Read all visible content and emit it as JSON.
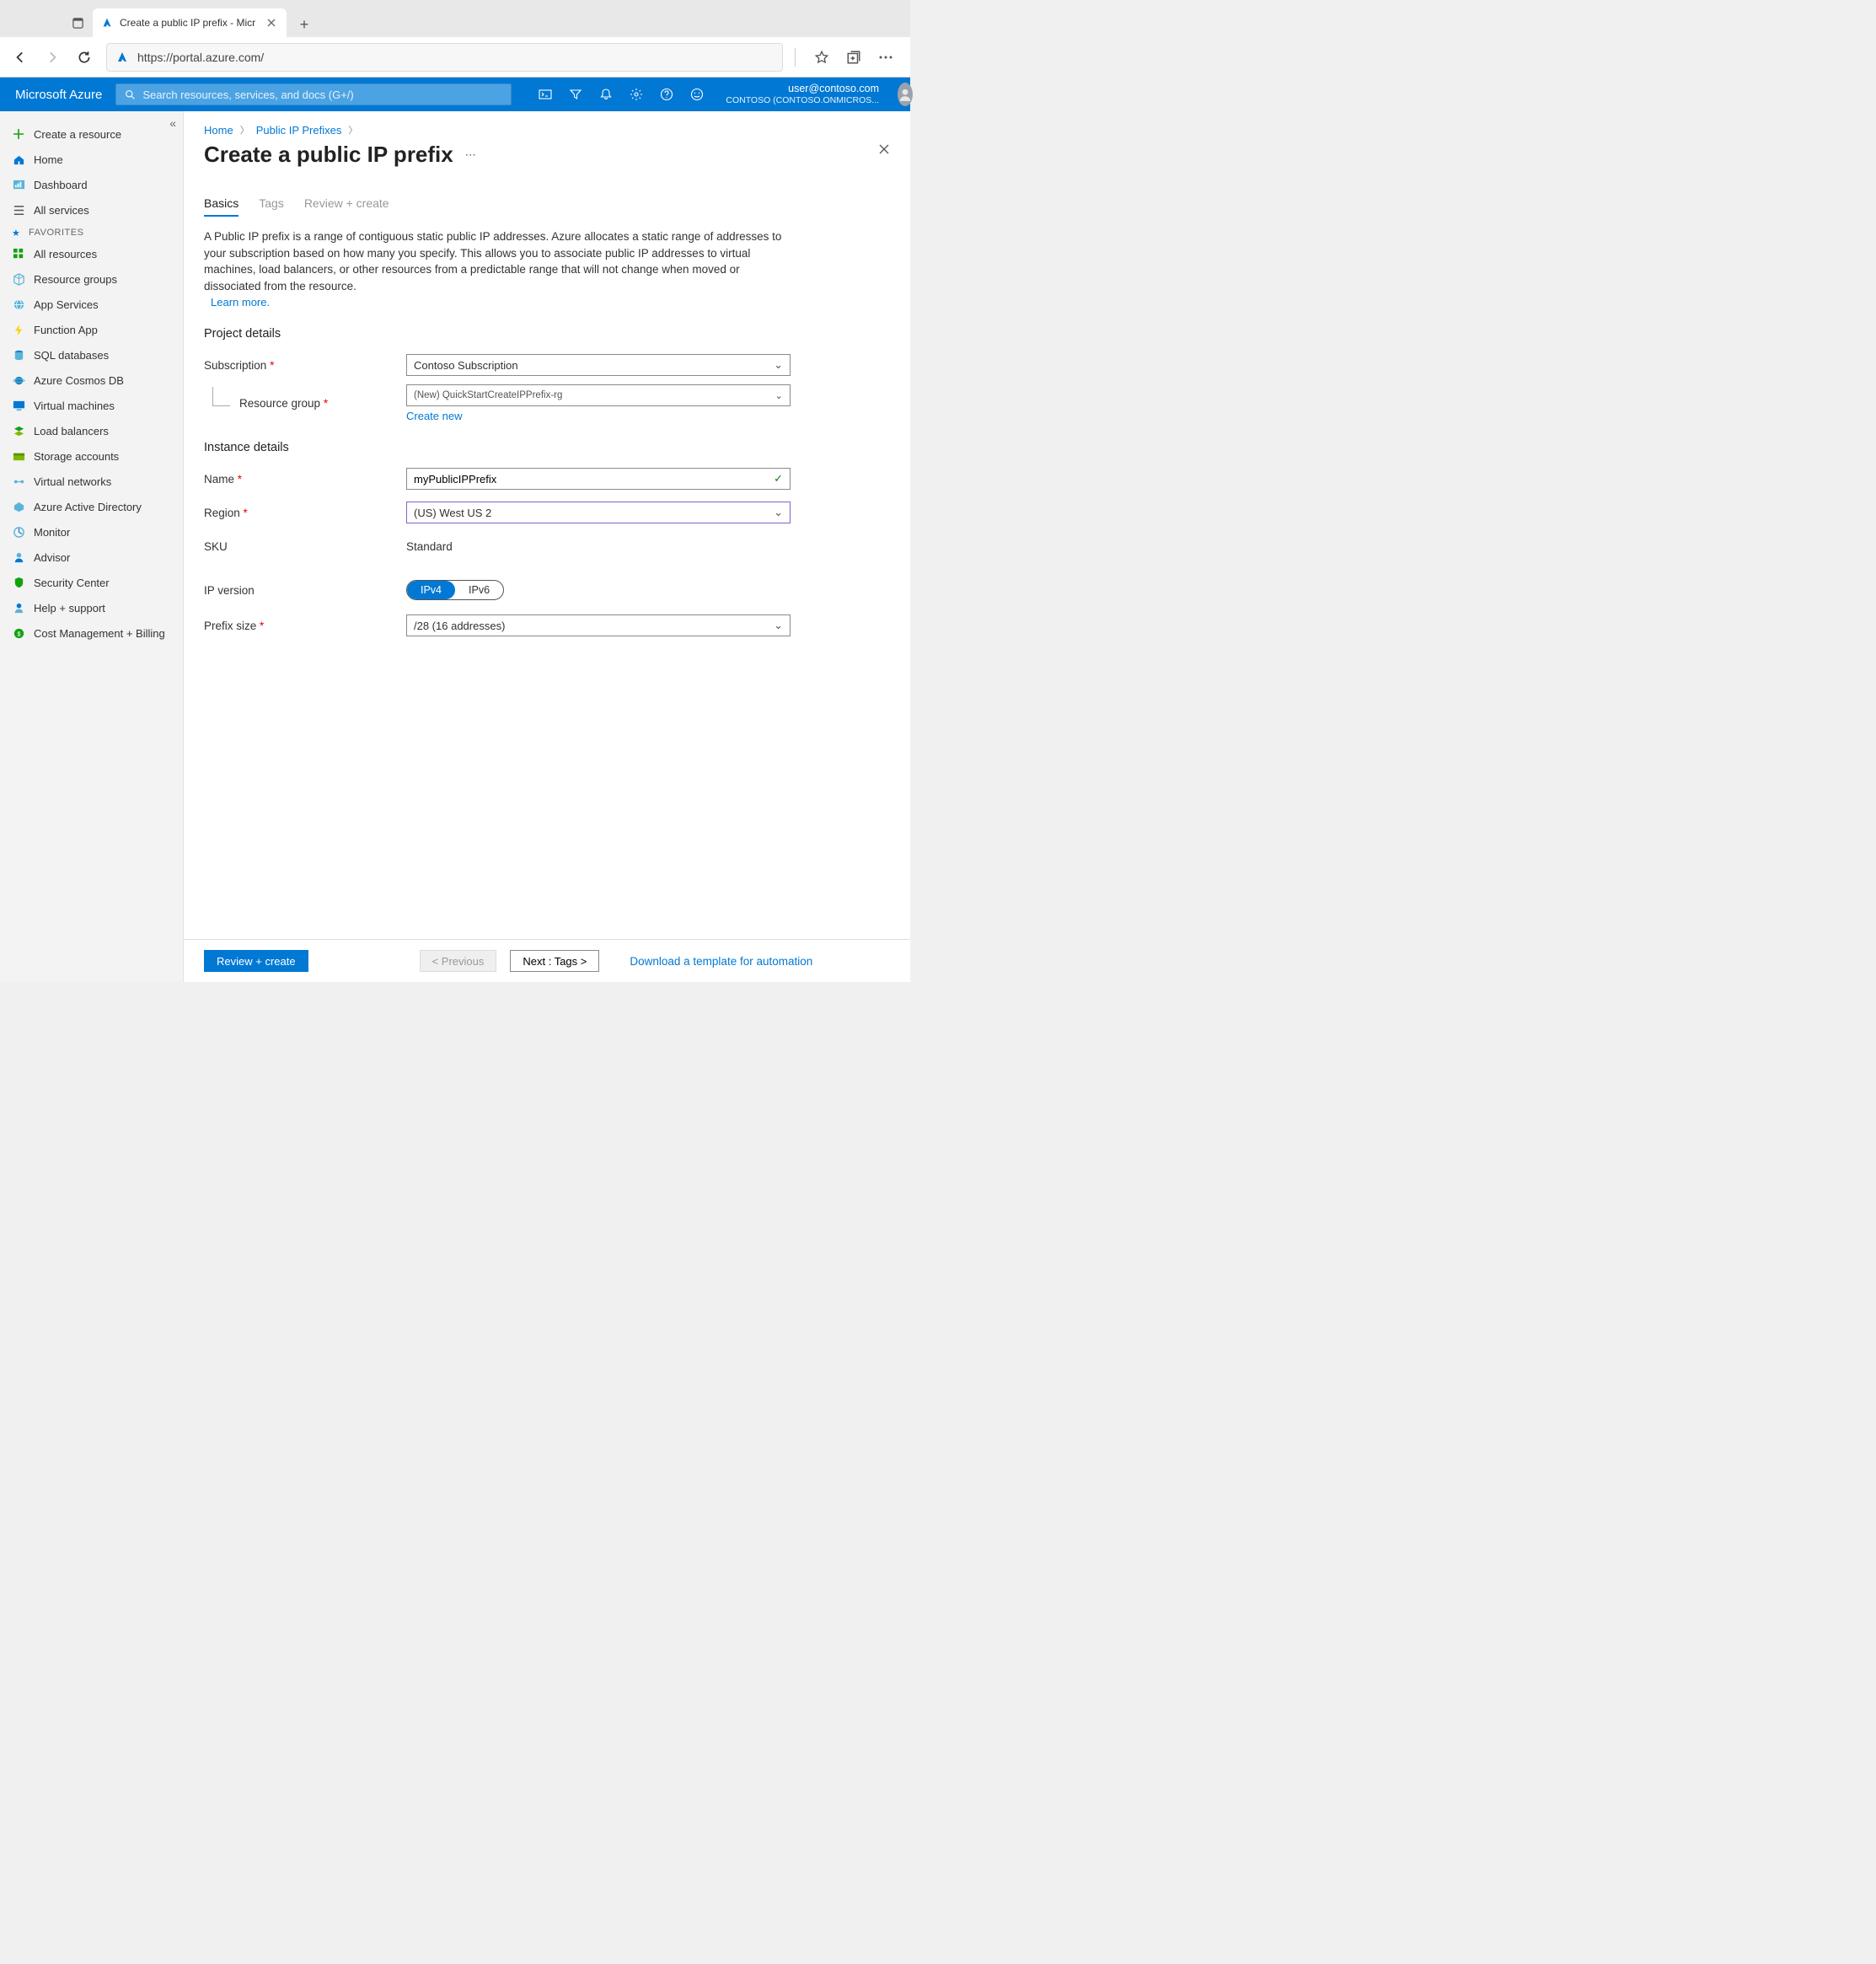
{
  "browser": {
    "tab_title": "Create a public IP prefix - Micr",
    "url": "https://portal.azure.com/"
  },
  "header": {
    "brand": "Microsoft Azure",
    "search_placeholder": "Search resources, services, and docs (G+/)",
    "user_email": "user@contoso.com",
    "user_tenant": "CONTOSO (CONTOSO.ONMICROS..."
  },
  "sidebar": {
    "top": [
      {
        "label": "Create a resource"
      },
      {
        "label": "Home"
      },
      {
        "label": "Dashboard"
      },
      {
        "label": "All services"
      }
    ],
    "fav_header": "FAVORITES",
    "favs": [
      {
        "label": "All resources"
      },
      {
        "label": "Resource groups"
      },
      {
        "label": "App Services"
      },
      {
        "label": "Function App"
      },
      {
        "label": "SQL databases"
      },
      {
        "label": "Azure Cosmos DB"
      },
      {
        "label": "Virtual machines"
      },
      {
        "label": "Load balancers"
      },
      {
        "label": "Storage accounts"
      },
      {
        "label": "Virtual networks"
      },
      {
        "label": "Azure Active Directory"
      },
      {
        "label": "Monitor"
      },
      {
        "label": "Advisor"
      },
      {
        "label": "Security Center"
      },
      {
        "label": "Help + support"
      },
      {
        "label": "Cost Management + Billing"
      }
    ]
  },
  "crumbs": {
    "home": "Home",
    "prefixes": "Public IP Prefixes"
  },
  "page": {
    "title": "Create a public IP prefix",
    "tabs": {
      "basics": "Basics",
      "tags": "Tags",
      "review": "Review + create"
    },
    "desc": "A Public IP prefix is a range of contiguous static public IP addresses. Azure allocates a static range of addresses to your subscription based on how many you specify. This allows you to associate public IP addresses to virtual machines, load balancers, or other resources from a predictable range that will not change when moved or dissociated from the resource.",
    "learn": "Learn more.",
    "project_h": "Project details",
    "instance_h": "Instance details",
    "labels": {
      "subscription": "Subscription",
      "rg": "Resource group",
      "create_new": "Create new",
      "name": "Name",
      "region": "Region",
      "sku": "SKU",
      "ipver": "IP version",
      "prefix": "Prefix size"
    },
    "values": {
      "subscription": "Contoso Subscription",
      "rg": "(New) QuickStartCreateIPPrefix-rg",
      "name": "myPublicIPPrefix",
      "region": "(US) West US 2",
      "sku": "Standard",
      "ipv4": "IPv4",
      "ipv6": "IPv6",
      "prefix": "/28 (16 addresses)"
    }
  },
  "footer": {
    "review": "Review + create",
    "prev": "< Previous",
    "next": "Next : Tags >",
    "download": "Download a template for automation"
  }
}
